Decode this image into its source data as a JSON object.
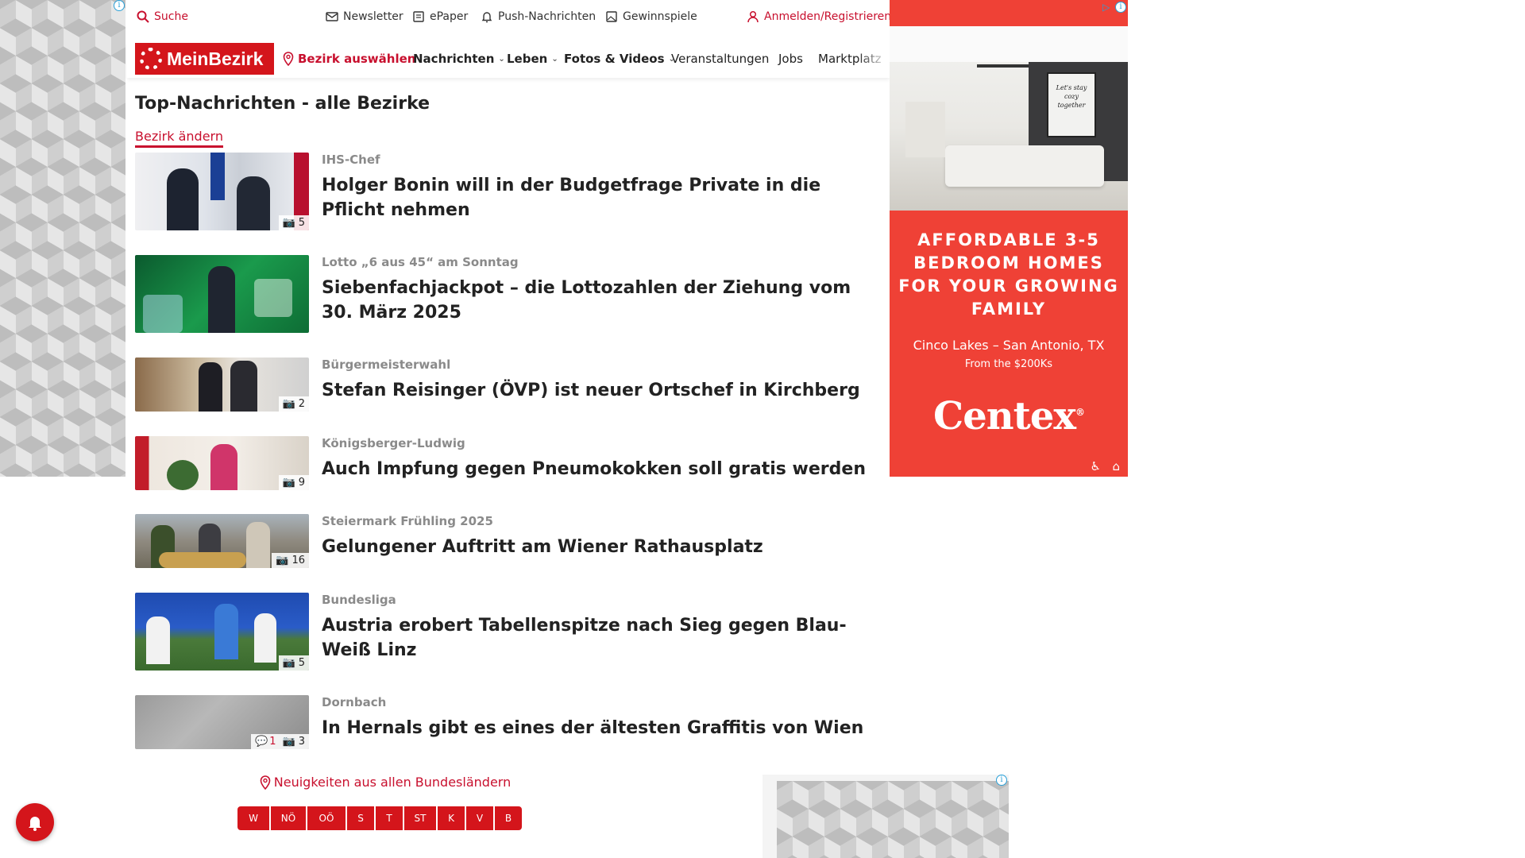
{
  "topbar": {
    "search": "Suche",
    "newsletter": "Newsletter",
    "epaper": "ePaper",
    "push": "Push-Nachrichten",
    "games": "Gewinnspiele",
    "login": "Anmelden/Registrieren"
  },
  "nav": {
    "logo": "MeinBezirk",
    "district": "Bezirk auswählen",
    "items": [
      "Nachrichten",
      "Leben",
      "Fotos & Videos",
      "Veranstaltungen",
      "Jobs",
      "Marktplatz"
    ]
  },
  "page": {
    "title": "Top-Nachrichten - alle Bezirke",
    "change_district": "Bezirk ändern"
  },
  "articles": [
    {
      "kicker": "IHS-Chef",
      "headline": "Holger Bonin will in der Budgetfrage Private in die Pflicht nehmen",
      "photos": "5",
      "comments": ""
    },
    {
      "kicker": "Lotto „6 aus 45“ am Sonntag",
      "headline": "Siebenfachjackpot – die Lottozahlen der Ziehung vom 30. März 2025",
      "photos": "",
      "comments": ""
    },
    {
      "kicker": "Bürgermeisterwahl",
      "headline": "Stefan Reisinger (ÖVP) ist neuer Ortschef in Kirchberg",
      "photos": "2",
      "comments": ""
    },
    {
      "kicker": "Königsberger-Ludwig",
      "headline": "Auch Impfung gegen Pneumokokken soll gratis werden",
      "photos": "9",
      "comments": ""
    },
    {
      "kicker": "Steiermark Frühling 2025",
      "headline": "Gelungener Auftritt am Wiener Rathausplatz",
      "photos": "16",
      "comments": ""
    },
    {
      "kicker": "Bundesliga",
      "headline": "Austria erobert Tabellenspitze nach Sieg gegen Blau-Weiß Linz",
      "photos": "5",
      "comments": ""
    },
    {
      "kicker": "Dornbach",
      "headline": "In Hernals gibt es eines der ältesten Graffitis von Wien",
      "photos": "3",
      "comments": "1"
    }
  ],
  "regions": {
    "title": "Neuigkeiten aus allen Bundesländern",
    "items": [
      "W",
      "NÖ",
      "OÖ",
      "S",
      "T",
      "ST",
      "K",
      "V",
      "B"
    ]
  },
  "ad": {
    "headline": "AFFORDABLE 3-5 BEDROOM HOMES FOR YOUR GROWING FAMILY",
    "location": "Cinco Lakes – San Antonio, TX",
    "price": "From the $200Ks",
    "brand": "Centex",
    "brand_mark": "®",
    "photo_text": "Let's stay cozy together"
  },
  "colors": {
    "brand_red": "#d4151b",
    "link_red": "#c8102e",
    "ad_red": "#ef4136"
  }
}
